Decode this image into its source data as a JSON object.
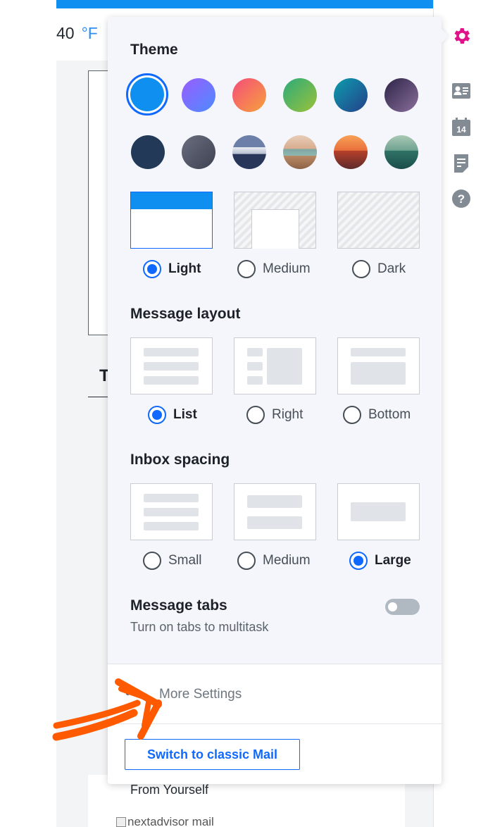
{
  "background": {
    "weather_temp": "40",
    "weather_unit": "°F",
    "partial_heading": "T",
    "from_text": "From Yourself",
    "broken_image_alt": "nextadvisor mail"
  },
  "rail": {
    "icons": [
      "gear-icon",
      "contacts-icon",
      "calendar-icon",
      "notes-icon",
      "help-icon"
    ],
    "calendar_day": "14",
    "help_glyph": "?",
    "accent_color": "#e0128a"
  },
  "settings": {
    "theme_title": "Theme",
    "theme_swatches": [
      {
        "name": "blue",
        "color": "#0f8ff0",
        "selected": true
      },
      {
        "name": "violet",
        "color": "#7b6cff"
      },
      {
        "name": "sunset",
        "color": "#f0735a"
      },
      {
        "name": "green",
        "color": "#43a86a"
      },
      {
        "name": "teal",
        "color": "#1d6a9b"
      },
      {
        "name": "purple-dusk",
        "color": "#4d3d63"
      },
      {
        "name": "navy",
        "color": "#223a57"
      },
      {
        "name": "slate",
        "color": "#54586a"
      },
      {
        "name": "mountain-photo",
        "color": "#3e4b6e"
      },
      {
        "name": "camper-photo",
        "color": "#b8876a"
      },
      {
        "name": "autumn-photo",
        "color": "#e0733e"
      },
      {
        "name": "lake-photo",
        "color": "#3f7f72"
      }
    ],
    "theme_brightness": [
      {
        "label": "Light",
        "selected": true
      },
      {
        "label": "Medium",
        "selected": false
      },
      {
        "label": "Dark",
        "selected": false
      }
    ],
    "layout_title": "Message layout",
    "layout_options": [
      {
        "label": "List",
        "selected": true
      },
      {
        "label": "Right",
        "selected": false
      },
      {
        "label": "Bottom",
        "selected": false
      }
    ],
    "spacing_title": "Inbox spacing",
    "spacing_options": [
      {
        "label": "Small",
        "selected": false
      },
      {
        "label": "Medium",
        "selected": false
      },
      {
        "label": "Large",
        "selected": true
      }
    ],
    "tabs_title": "Message tabs",
    "tabs_subtitle": "Turn on tabs to multitask",
    "tabs_enabled": false,
    "more_dots": "•••",
    "more_settings_label": "More Settings",
    "classic_button_label": "Switch to classic Mail",
    "accent_color": "#0f69ff"
  },
  "annotation": {
    "type": "hand-drawn arrow",
    "color": "#ff5a00",
    "points_to": "More Settings"
  }
}
